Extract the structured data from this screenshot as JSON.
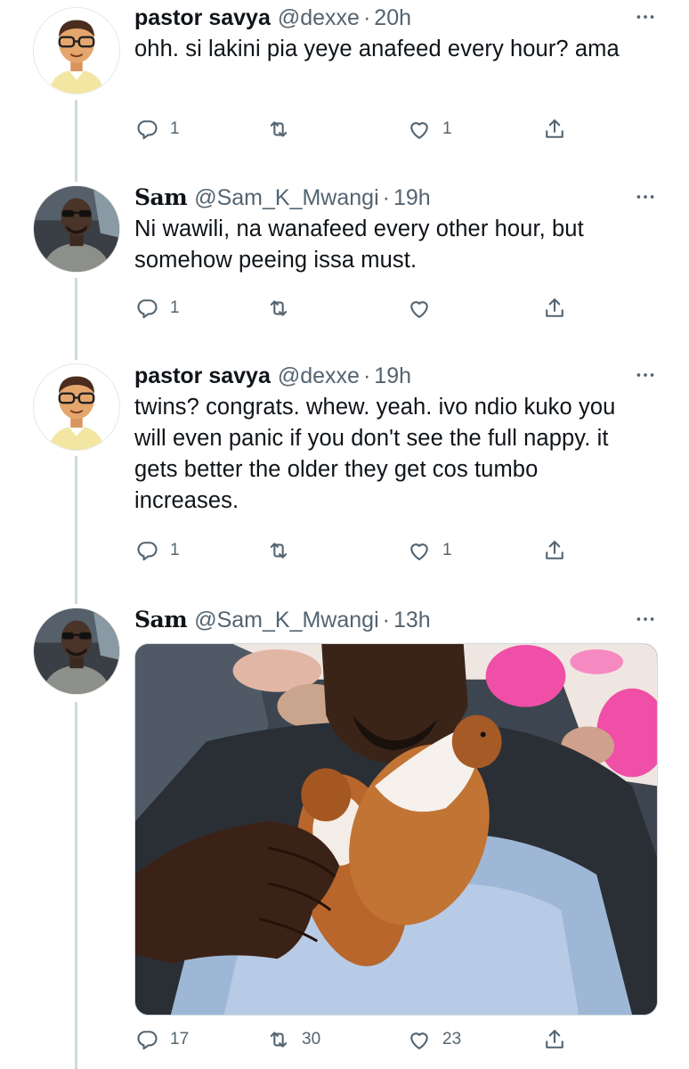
{
  "tweets": [
    {
      "author": "pastor savya",
      "handle": "@dexxe",
      "sep": "·",
      "time": "20h",
      "text": "ohh. si lakini pia yeye anafeed every hour? ama",
      "replies": "1",
      "retweets": "",
      "likes": "1"
    },
    {
      "author": "Sam",
      "handle": "@Sam_K_Mwangi",
      "sep": "·",
      "time": "19h",
      "text": "Ni wawili, na wanafeed every other hour, but somehow peeing issa must.",
      "replies": "1",
      "retweets": "",
      "likes": ""
    },
    {
      "author": "pastor savya",
      "handle": "@dexxe",
      "sep": "·",
      "time": "19h",
      "text": "twins? congrats. whew. yeah. ivo ndio kuko you will even panic if you don't see the full nappy. it gets better the older they get cos tumbo increases.",
      "replies": "1",
      "retweets": "",
      "likes": "1"
    },
    {
      "author": "Sam",
      "handle": "@Sam_K_Mwangi",
      "sep": "·",
      "time": "13h",
      "text": "",
      "replies": "17",
      "retweets": "30",
      "likes": "23"
    }
  ],
  "colors": {
    "text": "#0f1419",
    "muted": "#536471",
    "thread_line": "#cfd9de"
  },
  "icons": [
    "reply-icon",
    "retweet-icon",
    "like-icon",
    "share-icon",
    "more-icon"
  ]
}
